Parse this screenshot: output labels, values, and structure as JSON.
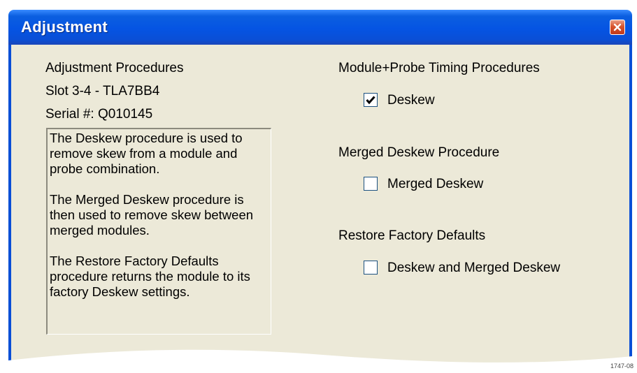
{
  "window": {
    "title": "Adjustment",
    "close_icon": "close-icon"
  },
  "left": {
    "heading": "Adjustment Procedures",
    "slot": "Slot 3-4 - TLA7BB4",
    "serial": "Serial #: Q010145",
    "description": [
      "The Deskew procedure is used to remove skew from a module and probe combination.",
      "The Merged Deskew procedure is then used to remove skew between merged modules.",
      "The Restore Factory Defaults procedure returns the module to its factory Deskew settings."
    ]
  },
  "right": {
    "group1": {
      "title": "Module+Probe Timing Procedures",
      "option": "Deskew",
      "checked": true
    },
    "group2": {
      "title": "Merged Deskew Procedure",
      "option": "Merged Deskew",
      "checked": false
    },
    "group3": {
      "title": "Restore Factory Defaults",
      "option": "Deskew and Merged Deskew",
      "checked": false
    }
  },
  "figure_id": "1747-08",
  "colors": {
    "titlebar": "#0554e3",
    "client": "#ece9d8",
    "close": "#d8542c"
  }
}
